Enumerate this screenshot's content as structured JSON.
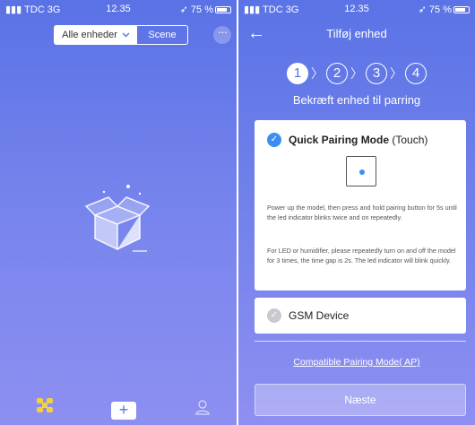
{
  "left": {
    "status": {
      "carrier": "TDC",
      "network": "3G",
      "time": "12.35",
      "battery": "75 %"
    },
    "segment": {
      "devices_label": "Alle enheder",
      "scene_label": "Scene"
    },
    "more_label": "···",
    "tab_add_label": "+"
  },
  "right": {
    "status": {
      "carrier": "TDC",
      "network": "3G",
      "time": "12.35",
      "battery": "75 %"
    },
    "nav": {
      "back": "←",
      "title": "Tilføj enhed"
    },
    "steps": [
      "1",
      "2",
      "3",
      "4"
    ],
    "step_label": "Bekræft enhed til parring",
    "quick": {
      "title": "Quick Pairing Mode",
      "suffix": "(Touch)",
      "desc1": "Power up the model, then press and hold pairing button for 5s until the led indicator blinks twice and on repeatedly.",
      "desc2": "For LED or humidifier, please repeatedly turn on and off the model for 3 times, the time gap is 2s. The led indicator will blink quickly."
    },
    "gsm": {
      "title": "GSM Device"
    },
    "compat_link": "Compatible Pairing Mode( AP)",
    "next_label": "Næste"
  },
  "colors": {
    "accent": "#5a72e6",
    "check": "#3b8ff0"
  }
}
